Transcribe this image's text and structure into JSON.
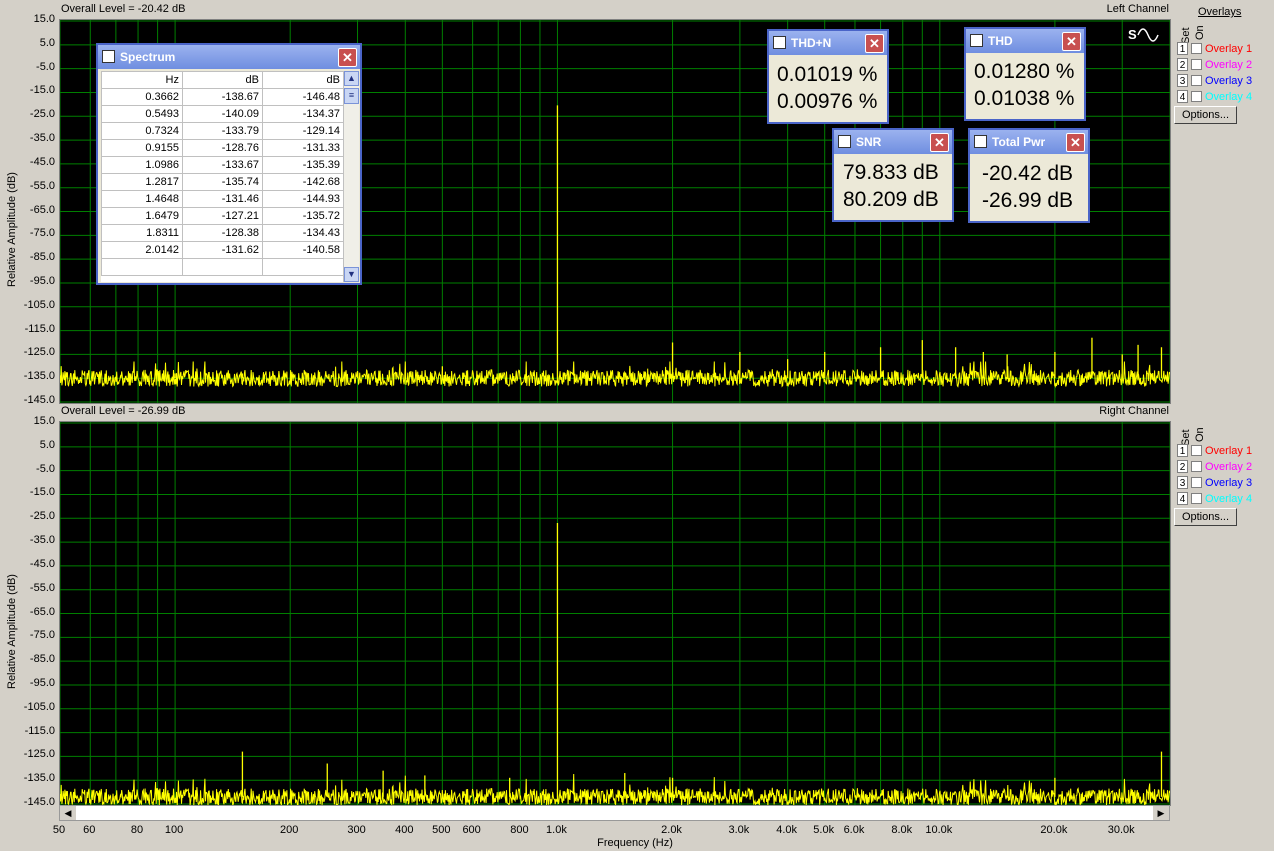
{
  "colors": {
    "trace": "#ffff00",
    "grid": "#007f00",
    "plot_bg": "#000000",
    "overlay1": "#ff0000",
    "overlay2": "#ff00ff",
    "overlay3": "#0000ff",
    "overlay4": "#00ffff"
  },
  "top": {
    "overall_level": "Overall Level = -20.42 dB",
    "channel": "Left Channel"
  },
  "bottom": {
    "overall_level": "Overall Level = -26.99 dB",
    "channel": "Right Channel"
  },
  "y_axis_label": "Relative Amplitude (dB)",
  "x_axis_label": "Frequency (Hz)",
  "y_ticks": [
    "15.0",
    "5.0",
    "-5.0",
    "-15.0",
    "-25.0",
    "-35.0",
    "-45.0",
    "-55.0",
    "-65.0",
    "-75.0",
    "-85.0",
    "-95.0",
    "-105.0",
    "-115.0",
    "-125.0",
    "-135.0",
    "-145.0"
  ],
  "x_ticks": [
    "50",
    "60",
    "80",
    "100",
    "200",
    "300",
    "400",
    "500",
    "600",
    "800",
    "1.0k",
    "2.0k",
    "3.0k",
    "4.0k",
    "5.0k",
    "6.0k",
    "8.0k",
    "10.0k",
    "20.0k",
    "30.0k"
  ],
  "overlays": {
    "header": "Overlays",
    "set_label": "Set",
    "on_label": "On",
    "items": [
      {
        "num": "1",
        "label": "Overlay 1"
      },
      {
        "num": "2",
        "label": "Overlay 2"
      },
      {
        "num": "3",
        "label": "Overlay 3"
      },
      {
        "num": "4",
        "label": "Overlay 4"
      }
    ],
    "options_label": "Options..."
  },
  "spectrum_window": {
    "title": "Spectrum",
    "close": "✕",
    "headers": [
      "Hz",
      "dB",
      "dB"
    ],
    "rows": [
      [
        "0.3662",
        "-138.67",
        "-146.48"
      ],
      [
        "0.5493",
        "-140.09",
        "-134.37"
      ],
      [
        "0.7324",
        "-133.79",
        "-129.14"
      ],
      [
        "0.9155",
        "-128.76",
        "-131.33"
      ],
      [
        "1.0986",
        "-133.67",
        "-135.39"
      ],
      [
        "1.2817",
        "-135.74",
        "-142.68"
      ],
      [
        "1.4648",
        "-131.46",
        "-144.93"
      ],
      [
        "1.6479",
        "-127.21",
        "-135.72"
      ],
      [
        "1.8311",
        "-128.38",
        "-134.43"
      ],
      [
        "2.0142",
        "-131.62",
        "-140.58"
      ]
    ]
  },
  "meters": {
    "thdn": {
      "title": "THD+N",
      "v1": "0.01019 %",
      "v2": "0.00976 %"
    },
    "thd": {
      "title": "THD",
      "v1": "0.01280 %",
      "v2": "0.01038 %"
    },
    "snr": {
      "title": "SNR",
      "v1": "79.833 dB",
      "v2": "80.209 dB"
    },
    "pwr": {
      "title": "Total Pwr",
      "v1": "-20.42 dB",
      "v2": "-26.99 dB"
    }
  },
  "chart_data": [
    {
      "type": "line",
      "title": "Left Channel",
      "xlabel": "Frequency (Hz)",
      "ylabel": "Relative Amplitude (dB)",
      "x_scale": "log",
      "xlim": [
        50,
        40000
      ],
      "ylim": [
        -145,
        15
      ],
      "grid": true,
      "noise_floor_db": -135,
      "peaks": [
        {
          "x": 100,
          "y": -133
        },
        {
          "x": 150,
          "y": -133
        },
        {
          "x": 300,
          "y": -132
        },
        {
          "x": 500,
          "y": -130
        },
        {
          "x": 1000,
          "y": -20.42
        },
        {
          "x": 2000,
          "y": -120
        },
        {
          "x": 3000,
          "y": -124
        },
        {
          "x": 4000,
          "y": -127
        },
        {
          "x": 5000,
          "y": -124
        },
        {
          "x": 7000,
          "y": -122
        },
        {
          "x": 9000,
          "y": -119
        },
        {
          "x": 11000,
          "y": -122
        },
        {
          "x": 13000,
          "y": -124
        },
        {
          "x": 15000,
          "y": -125
        },
        {
          "x": 20000,
          "y": -124
        },
        {
          "x": 25000,
          "y": -118
        },
        {
          "x": 30000,
          "y": -125
        },
        {
          "x": 33000,
          "y": -121
        },
        {
          "x": 38000,
          "y": -122
        }
      ]
    },
    {
      "type": "line",
      "title": "Right Channel",
      "xlabel": "Frequency (Hz)",
      "ylabel": "Relative Amplitude (dB)",
      "x_scale": "log",
      "xlim": [
        50,
        40000
      ],
      "ylim": [
        -145,
        15
      ],
      "grid": true,
      "noise_floor_db": -142,
      "peaks": [
        {
          "x": 150,
          "y": -123
        },
        {
          "x": 250,
          "y": -128
        },
        {
          "x": 350,
          "y": -131
        },
        {
          "x": 450,
          "y": -133
        },
        {
          "x": 750,
          "y": -134
        },
        {
          "x": 1000,
          "y": -26.99
        },
        {
          "x": 1500,
          "y": -132
        },
        {
          "x": 2000,
          "y": -134
        },
        {
          "x": 20000,
          "y": -134
        },
        {
          "x": 38000,
          "y": -123
        }
      ]
    }
  ]
}
